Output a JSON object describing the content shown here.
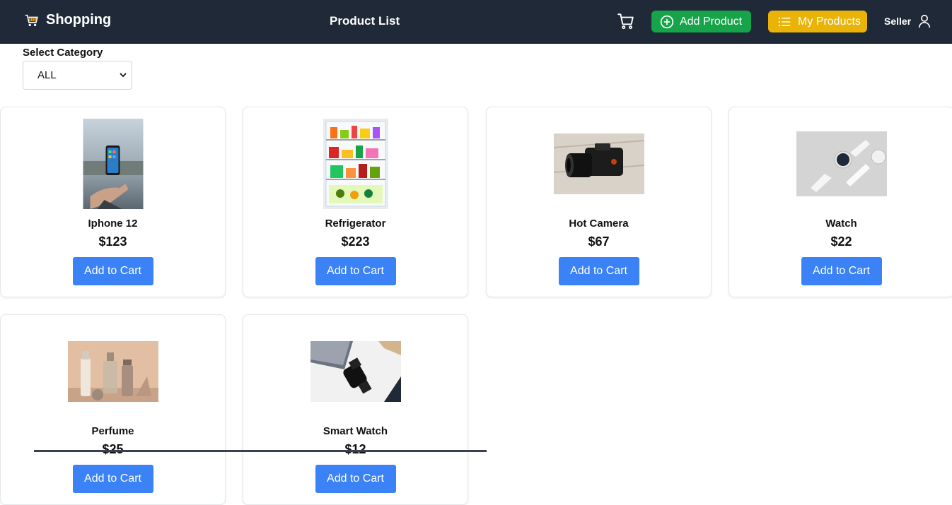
{
  "navbar": {
    "brand": "Shopping",
    "title": "Product List",
    "add_product_label": "Add Product",
    "my_products_label": "My Products",
    "seller_label": "Seller",
    "icons": [
      "cart-icon",
      "plus-circle-icon",
      "list-icon",
      "user-icon"
    ],
    "colors": {
      "bg": "#1f2937",
      "add": "#16a34a",
      "my": "#eab308"
    }
  },
  "filter": {
    "label": "Select Category",
    "selected": "ALL"
  },
  "products": [
    {
      "name": "Iphone 12",
      "price": "$123",
      "cta": "Add to Cart"
    },
    {
      "name": "Refrigerator",
      "price": "$223",
      "cta": "Add to Cart"
    },
    {
      "name": "Hot Camera",
      "price": "$67",
      "cta": "Add to Cart"
    },
    {
      "name": "Watch",
      "price": "$22",
      "cta": "Add to Cart"
    },
    {
      "name": "Perfume",
      "price": "$25",
      "cta": "Add to Cart"
    },
    {
      "name": "Smart Watch",
      "price": "$12",
      "cta": "Add to Cart"
    }
  ]
}
